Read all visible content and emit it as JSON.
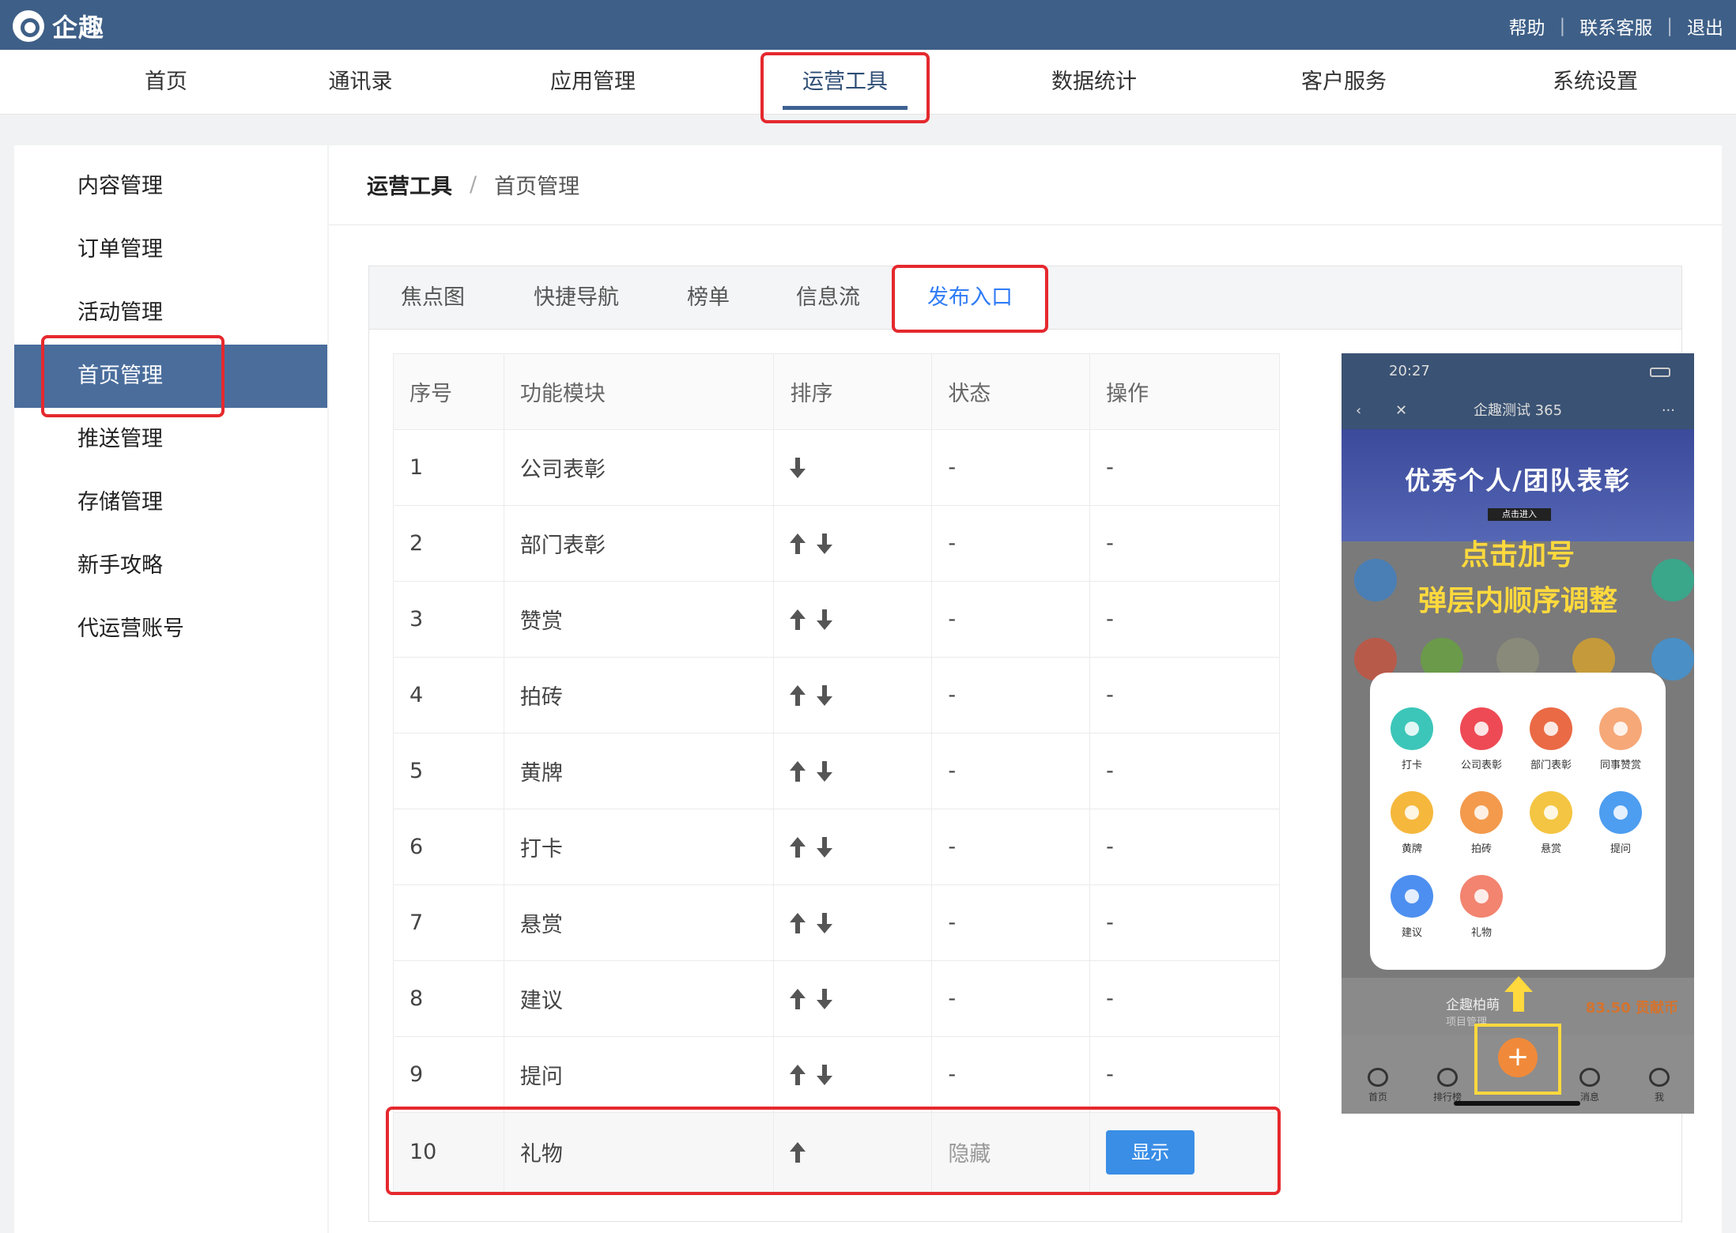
{
  "app": {
    "name": "企趣"
  },
  "toplinks": {
    "help": "帮助",
    "support": "联系客服",
    "logout": "退出"
  },
  "nav": [
    {
      "label": "首页"
    },
    {
      "label": "通讯录"
    },
    {
      "label": "应用管理"
    },
    {
      "label": "运营工具"
    },
    {
      "label": "数据统计"
    },
    {
      "label": "客户服务"
    },
    {
      "label": "系统设置"
    }
  ],
  "sidebar": [
    {
      "label": "内容管理"
    },
    {
      "label": "订单管理"
    },
    {
      "label": "活动管理"
    },
    {
      "label": "首页管理"
    },
    {
      "label": "推送管理"
    },
    {
      "label": "存储管理"
    },
    {
      "label": "新手攻略"
    },
    {
      "label": "代运营账号"
    }
  ],
  "breadcrumb": {
    "current": "运营工具",
    "sep": "/",
    "sub": "首页管理"
  },
  "tabs": [
    {
      "label": "焦点图"
    },
    {
      "label": "快捷导航"
    },
    {
      "label": "榜单"
    },
    {
      "label": "信息流"
    },
    {
      "label": "发布入口"
    }
  ],
  "table": {
    "headers": [
      "序号",
      "功能模块",
      "排序",
      "状态",
      "操作"
    ],
    "rows": [
      {
        "no": "1",
        "name": "公司表彰",
        "status": "-",
        "op": "-"
      },
      {
        "no": "2",
        "name": "部门表彰",
        "status": "-",
        "op": "-"
      },
      {
        "no": "3",
        "name": "赞赏",
        "status": "-",
        "op": "-"
      },
      {
        "no": "4",
        "name": "拍砖",
        "status": "-",
        "op": "-"
      },
      {
        "no": "5",
        "name": "黄牌",
        "status": "-",
        "op": "-"
      },
      {
        "no": "6",
        "name": "打卡",
        "status": "-",
        "op": "-"
      },
      {
        "no": "7",
        "name": "悬赏",
        "status": "-",
        "op": "-"
      },
      {
        "no": "8",
        "name": "建议",
        "status": "-",
        "op": "-"
      },
      {
        "no": "9",
        "name": "提问",
        "status": "-",
        "op": "-"
      },
      {
        "no": "10",
        "name": "礼物",
        "status": "隐藏",
        "op_button": "显示"
      }
    ]
  },
  "phone": {
    "time": "20:27",
    "title": "企趣测试 365",
    "banner_title": "优秀个人/团队表彰",
    "banner_sub": "点击进入",
    "hint1": "点击加号",
    "hint2": "弹层内顺序调整",
    "popup": [
      {
        "label": "打卡",
        "color": "#3cc6b9"
      },
      {
        "label": "公司表彰",
        "color": "#ee4a55"
      },
      {
        "label": "部门表彰",
        "color": "#ea6a45"
      },
      {
        "label": "同事赞赏",
        "color": "#f6a878"
      },
      {
        "label": "黄牌",
        "color": "#f5b83d"
      },
      {
        "label": "拍砖",
        "color": "#f39a4d"
      },
      {
        "label": "悬赏",
        "color": "#f4c542"
      },
      {
        "label": "提问",
        "color": "#4d9df0"
      },
      {
        "label": "建议",
        "color": "#4d8ff0"
      },
      {
        "label": "礼物",
        "color": "#f28470"
      }
    ],
    "user": "企趣柏萌",
    "user_sub": "项目管理",
    "coins": "83.50 贡献币",
    "tabbar": [
      "首页",
      "排行榜",
      "消息",
      "我"
    ]
  }
}
